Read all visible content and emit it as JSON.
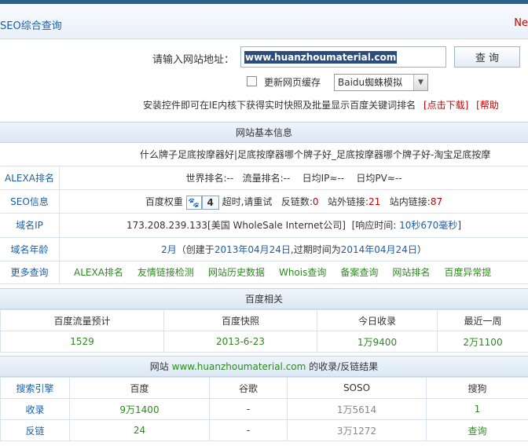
{
  "header": {
    "title": "SEO综合查询",
    "right_text": "Ne"
  },
  "form": {
    "url_label": "请输入网站地址：",
    "url_value": "www.huanzhoumaterial.com",
    "query_button": "查 询",
    "refresh_cache_label": "更新网页缓存",
    "spider_select_value": "Baidu蜘蛛模拟",
    "tip_text": "安装控件即可在IE内核下获得实时快照及批量显示百度关键词排名",
    "tip_download": "[点击下载]",
    "tip_help": "[帮助"
  },
  "basic_info": {
    "section_title": "网站基本信息",
    "site_title": "什么牌子足底按摩器好|足底按摩器哪个牌子好_足底按摩器哪个牌子好-淘宝足底按摩",
    "alexa": {
      "label": "ALEXA排名",
      "world_rank_label": "世界排名:",
      "world_rank_value": "--",
      "traffic_rank_label": "流量排名:",
      "traffic_rank_value": "--",
      "daily_ip_label": "日均IP≈",
      "daily_ip_value": "--",
      "daily_pv_label": "日均PV≈",
      "daily_pv_value": "--"
    },
    "seo": {
      "label": "SEO信息",
      "baidu_weight_label": "百度权重",
      "baidu_weight_value": "4",
      "timeout_text": "超时,请重试",
      "backlinks_label": "反链数:",
      "backlinks_value": "0",
      "external_links_label": "站外链接:",
      "external_links_value": "21",
      "internal_links_label": "站内链接:",
      "internal_links_value": "87"
    },
    "domain_ip": {
      "label": "域名IP",
      "ip_text": "173.208.239.133[美国 WholeSale Internet公司]",
      "response_label": "[响应时间:",
      "response_value": "10秒670毫秒",
      "response_close": "]"
    },
    "domain_age": {
      "label": "域名年龄",
      "age_value": "2月",
      "created_prefix": "（创建于",
      "created_date": "2013年04月24日",
      "expire_prefix": ",过期时间为",
      "expire_date": "2014年04月24日",
      "close": "）"
    },
    "more": {
      "label": "更多查询",
      "links": [
        "ALEXA排名",
        "友情链接检测",
        "网站历史数据",
        "Whois查询",
        "备案查询",
        "网站排名",
        "百度异常提"
      ]
    }
  },
  "baidu_related": {
    "section_title": "百度相关",
    "headers": [
      "百度流量预计",
      "百度快照",
      "今日收录",
      "最近一周"
    ],
    "values": [
      "1529",
      "2013-6-23",
      "1万9400",
      "2万1100"
    ]
  },
  "index_results": {
    "section_prefix": "网站",
    "section_site": "www.huanzhoumaterial.com",
    "section_suffix": "的收录/反链结果",
    "headers": [
      "搜索引擎",
      "百度",
      "谷歌",
      "SOSO",
      "搜狗"
    ],
    "rows": [
      {
        "label": "收录",
        "cells": [
          "9万1400",
          "-",
          "1万5614",
          "1"
        ]
      },
      {
        "label": "反链",
        "cells": [
          "24",
          "-",
          "3万1272",
          "查询"
        ]
      }
    ]
  },
  "colors": {
    "accent_blue": "#1e5ea8",
    "alert_red": "#cc0000",
    "value_green": "#2c8a1e"
  }
}
